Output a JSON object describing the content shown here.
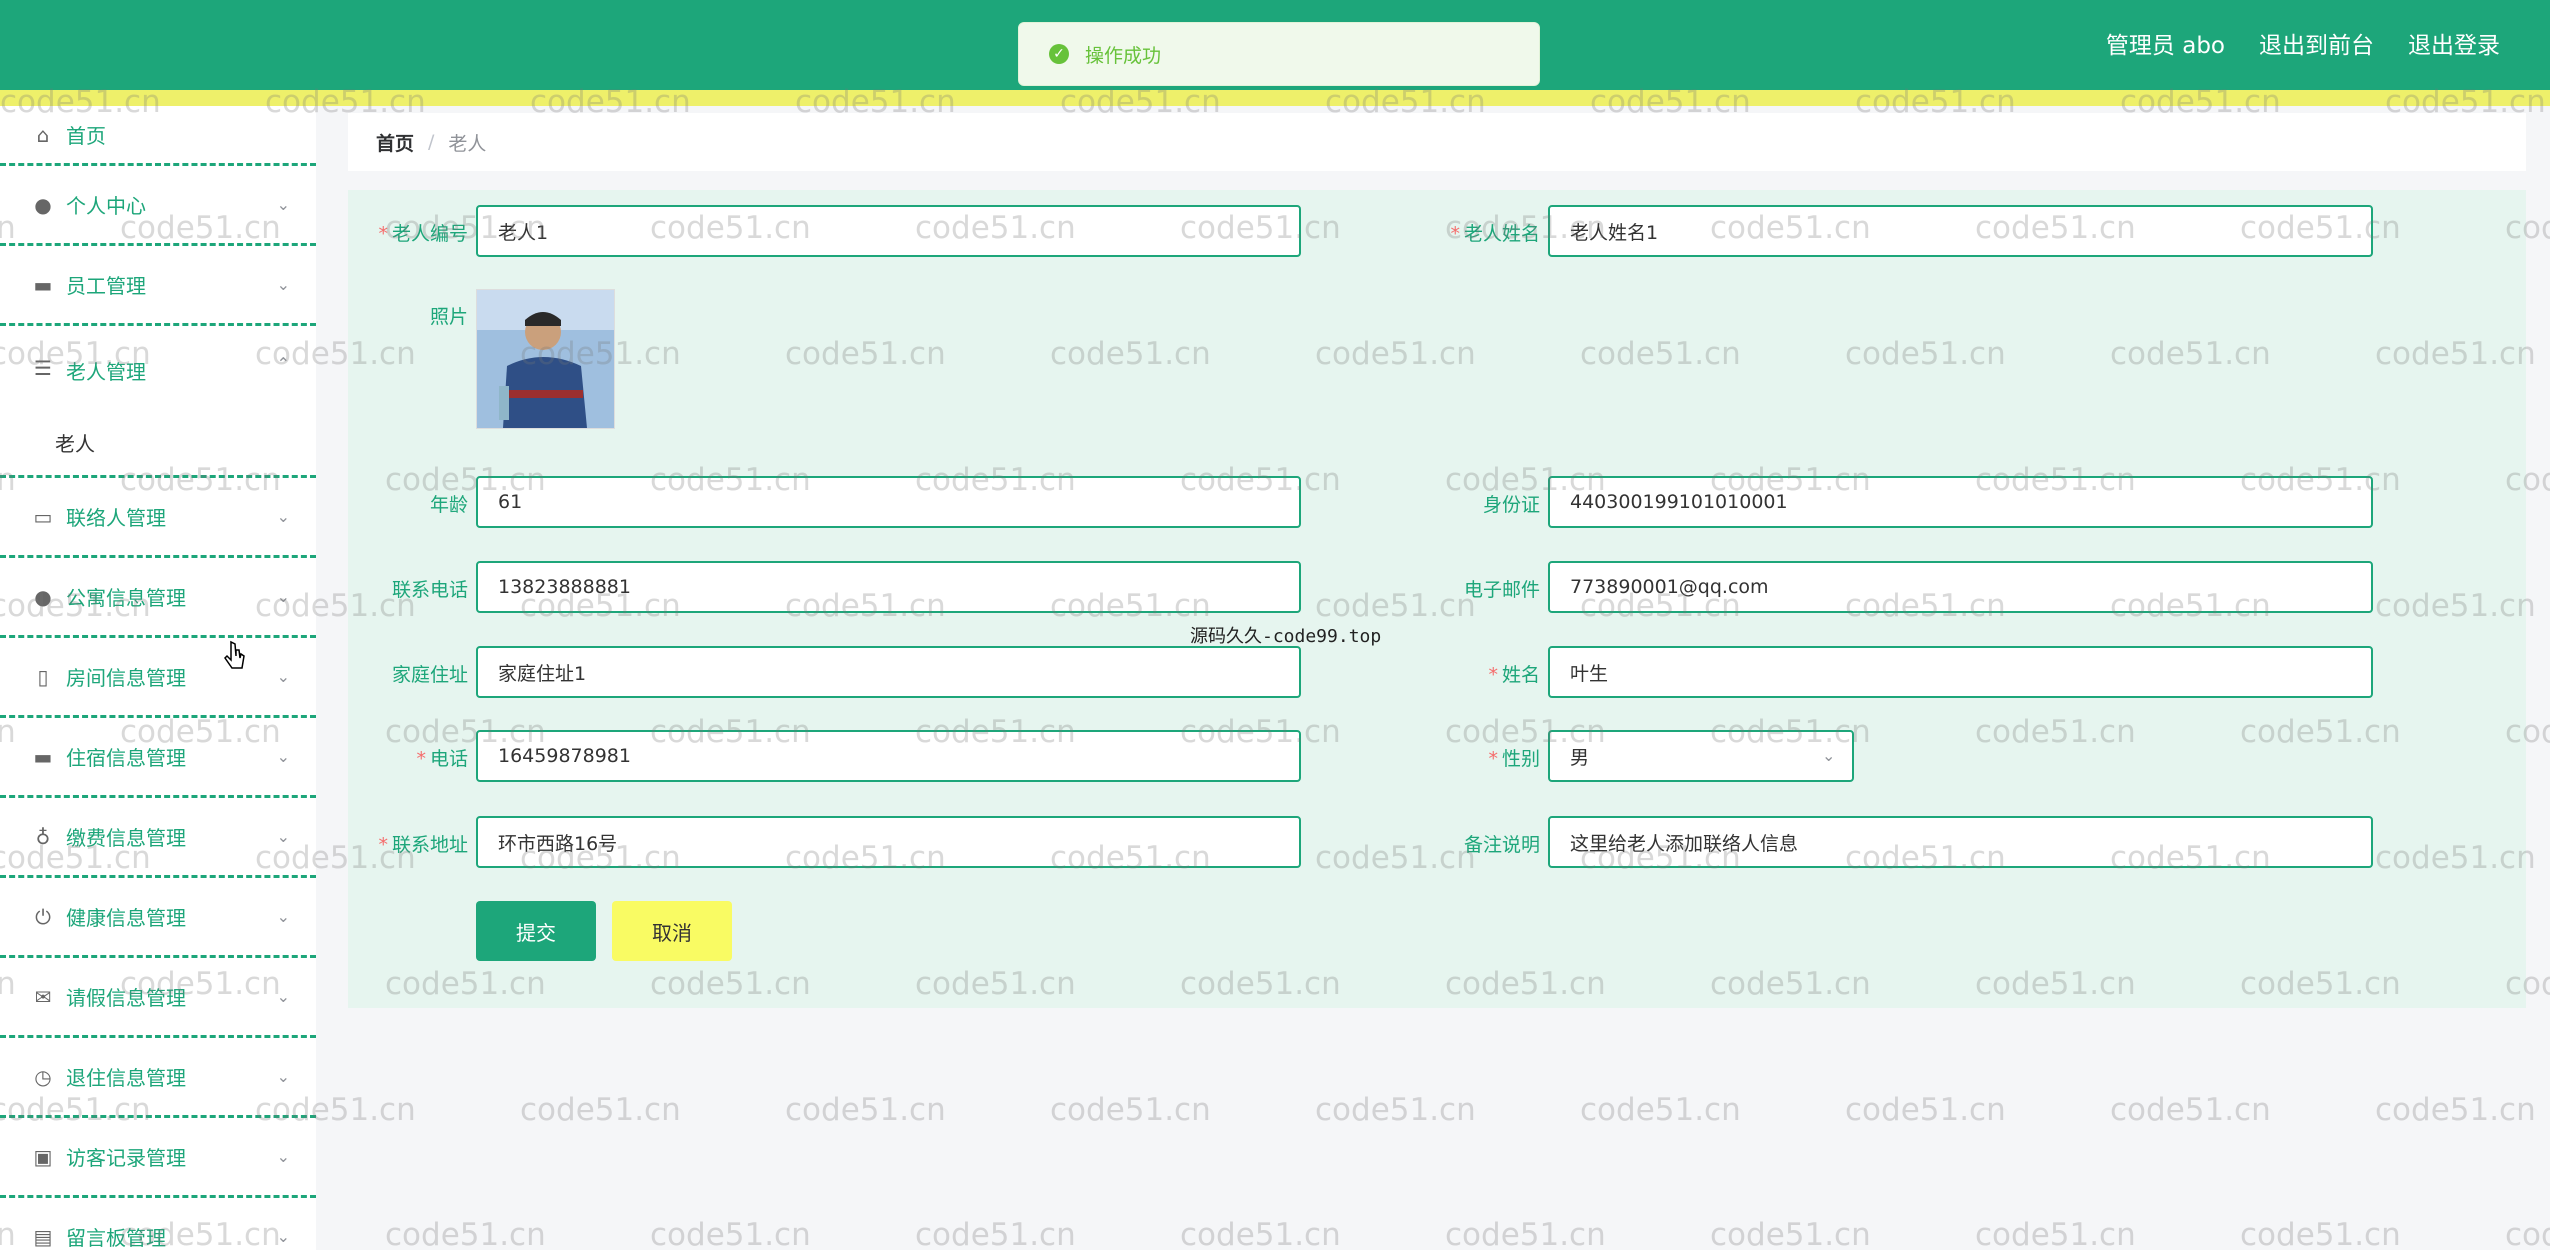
{
  "header": {
    "admin_label": "管理员 abo",
    "front_link": "退出到前台",
    "logout_link": "退出登录"
  },
  "toast": {
    "message": "操作成功"
  },
  "sidebar": {
    "items": [
      {
        "label": "首页",
        "icon": "home-icon"
      },
      {
        "label": "个人中心",
        "icon": "user-icon"
      },
      {
        "label": "员工管理",
        "icon": "chair-icon"
      },
      {
        "label": "老人管理",
        "icon": "list-icon"
      },
      {
        "label": "联络人管理",
        "icon": "card-icon"
      },
      {
        "label": "公寓信息管理",
        "icon": "user-icon"
      },
      {
        "label": "房间信息管理",
        "icon": "phone-icon"
      },
      {
        "label": "住宿信息管理",
        "icon": "chair-icon"
      },
      {
        "label": "缴费信息管理",
        "icon": "microphone-icon"
      },
      {
        "label": "健康信息管理",
        "icon": "power-icon"
      },
      {
        "label": "请假信息管理",
        "icon": "mail-icon"
      },
      {
        "label": "退住信息管理",
        "icon": "clock-icon"
      },
      {
        "label": "访客记录管理",
        "icon": "chat-icon"
      },
      {
        "label": "留言板管理",
        "icon": "cart-icon"
      }
    ],
    "sub_item": "老人"
  },
  "breadcrumb": {
    "home": "首页",
    "sep": "/",
    "current": "老人"
  },
  "form": {
    "elder_no": {
      "label": "老人编号",
      "value": "老人1"
    },
    "elder_name": {
      "label": "老人姓名",
      "value": "老人姓名1"
    },
    "photo": {
      "label": "照片"
    },
    "age": {
      "label": "年龄",
      "value": "61"
    },
    "id_card": {
      "label": "身份证",
      "value": "440300199101010001"
    },
    "phone": {
      "label": "联系电话",
      "value": "13823888881"
    },
    "email": {
      "label": "电子邮件",
      "value": "773890001@qq.com"
    },
    "home_address": {
      "label": "家庭住址",
      "value": "家庭住址1"
    },
    "contact_name": {
      "label": "姓名",
      "value": "叶生"
    },
    "contact_phone": {
      "label": "电话",
      "value": "16459878981"
    },
    "gender": {
      "label": "性别",
      "value": "男"
    },
    "contact_address": {
      "label": "联系地址",
      "value": "环市西路16号"
    },
    "remark": {
      "label": "备注说明",
      "value": "这里给老人添加联络人信息"
    },
    "submit_label": "提交",
    "cancel_label": "取消",
    "required_mark": "*"
  },
  "watermark": {
    "text": "code51.cn",
    "center_text": "源码久久-code99.top"
  },
  "colors": {
    "primary": "#1da67a",
    "stripe": "#eef06a",
    "cancel": "#f9fb63",
    "panel": "#e6f5ef"
  }
}
